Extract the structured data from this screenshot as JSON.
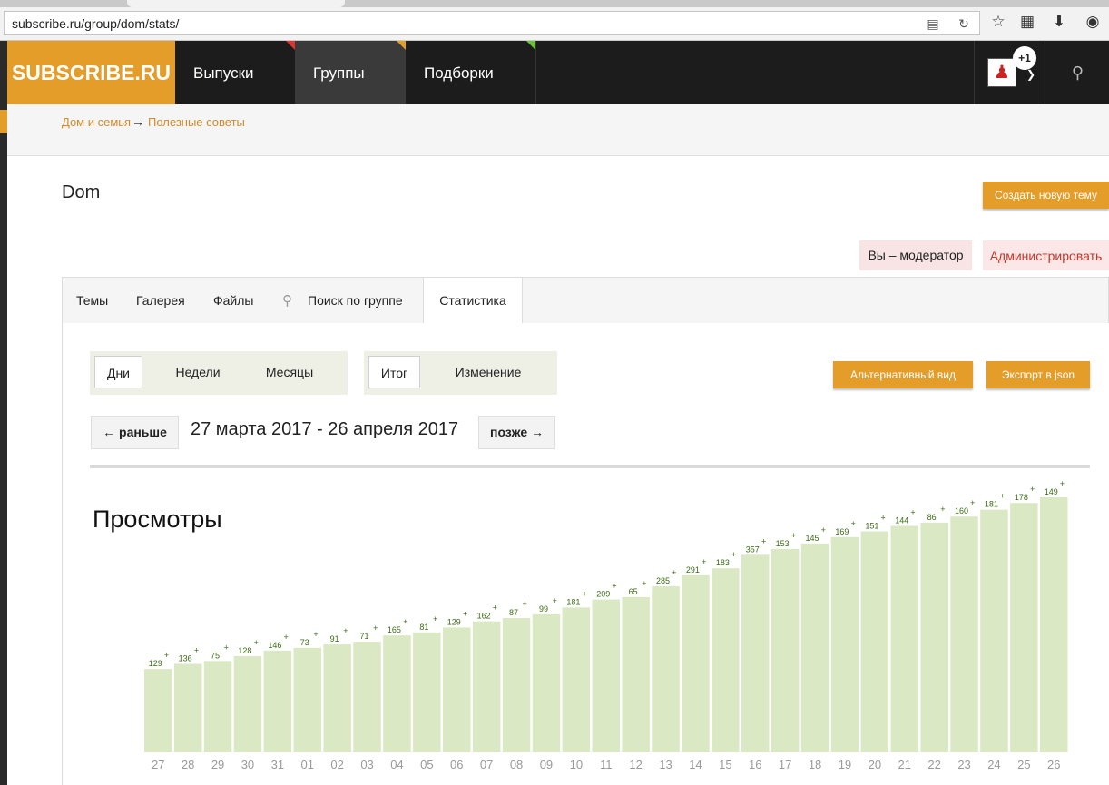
{
  "browser": {
    "url": "subscribe.ru/group/dom/stats/",
    "icons": [
      "reader-icon",
      "reload-icon",
      "star-icon",
      "reading-list-icon",
      "download-icon",
      "pocket-icon"
    ]
  },
  "header": {
    "logo": "SUBSCRIBE.RU",
    "nav": [
      "Выпуски",
      "Группы",
      "Подборки"
    ],
    "notification_badge": "+1"
  },
  "breadcrumb": {
    "items": [
      "Дом и семья",
      "Полезные советы"
    ],
    "separator": "→"
  },
  "group": {
    "title": "Dom",
    "create_topic": "Создать новую тему",
    "moderator_label": "Вы – модератор",
    "admin_link": "Администрировать"
  },
  "tabs": {
    "items": [
      "Темы",
      "Галерея",
      "Файлы",
      "Поиск по группе",
      "Статистика"
    ],
    "active": "Статистика"
  },
  "stats": {
    "period_options": [
      "Дни",
      "Недели",
      "Месяцы"
    ],
    "period_selected": "Дни",
    "mode_options": [
      "Итог",
      "Изменение"
    ],
    "mode_selected": "Итог",
    "alt_view": "Альтернативный вид",
    "export": "Экспорт в json",
    "prev": "← раньше",
    "next": "позже →",
    "range": "27 марта 2017 - 26 апреля 2017"
  },
  "colors": {
    "accent": "#e59d2a",
    "bar": "#dbe8c4",
    "increment": "#3b6b12"
  },
  "chart_data": {
    "type": "bar",
    "title": "Просмотры",
    "categories": [
      "27",
      "28",
      "29",
      "30",
      "31",
      "01",
      "02",
      "03",
      "04",
      "05",
      "06",
      "07",
      "08",
      "09",
      "10",
      "11",
      "12",
      "13",
      "14",
      "15",
      "16",
      "17",
      "18",
      "19",
      "20",
      "21",
      "22",
      "23",
      "24",
      "25",
      "26"
    ],
    "values": [
      2200,
      2336,
      2411,
      2539,
      2685,
      2758,
      2849,
      2920,
      3085,
      3166,
      3295,
      3457,
      3544,
      3643,
      3824,
      4033,
      4098,
      4383,
      4674,
      4857,
      5214,
      5367,
      5512,
      5681,
      5832,
      5976,
      6062,
      6222,
      6403,
      6581,
      6730
    ],
    "increments": [
      129,
      136,
      75,
      128,
      146,
      73,
      91,
      71,
      165,
      81,
      129,
      162,
      87,
      99,
      181,
      209,
      65,
      285,
      291,
      183,
      357,
      153,
      145,
      169,
      151,
      144,
      86,
      160,
      181,
      178,
      149
    ],
    "increment_prefix": "+"
  }
}
